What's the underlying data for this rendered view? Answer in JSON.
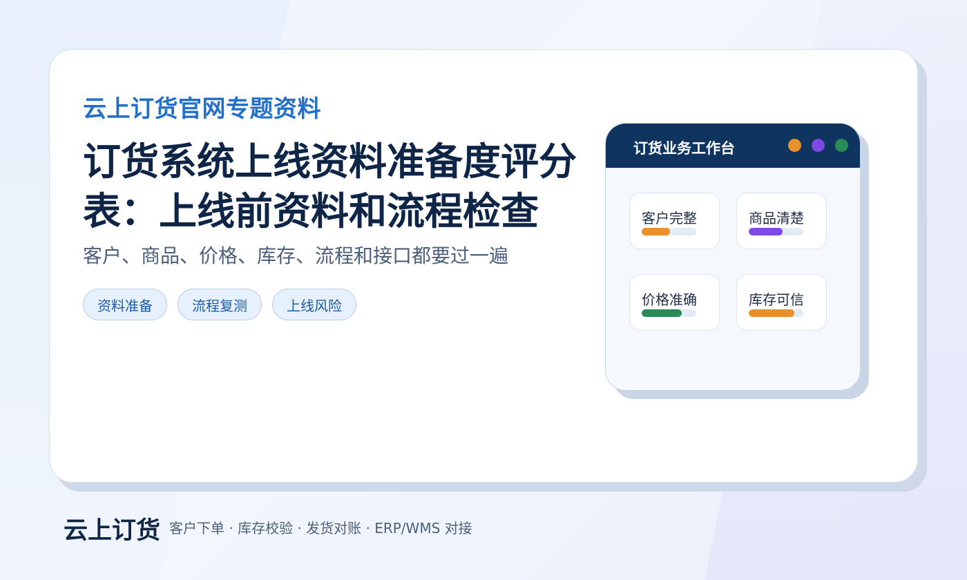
{
  "eyebrow": "云上订货官网专题资料",
  "title": "订货系统上线资料准备度评分表：上线前资料和流程检查",
  "subtitle": "客户、商品、价格、库存、流程和接口都要过一遍",
  "tags": [
    "资料准备",
    "流程复测",
    "上线风险"
  ],
  "panel": {
    "title": "订货业务工作台",
    "dot_colors": [
      "#e8902a",
      "#7f4ae3",
      "#2a8a58"
    ],
    "metrics": [
      {
        "label": "客户完整",
        "progress": 0.52,
        "color": "#e8902a"
      },
      {
        "label": "商品清楚",
        "progress": 0.62,
        "color": "#7f4ae3"
      },
      {
        "label": "价格准确",
        "progress": 0.73,
        "color": "#2a8a58"
      },
      {
        "label": "库存可信",
        "progress": 0.83,
        "color": "#e8902a"
      }
    ]
  },
  "footer": {
    "brand": "云上订货",
    "tagline": "客户下单 · 库存校验 · 发货对账 · ERP/WMS 对接"
  }
}
